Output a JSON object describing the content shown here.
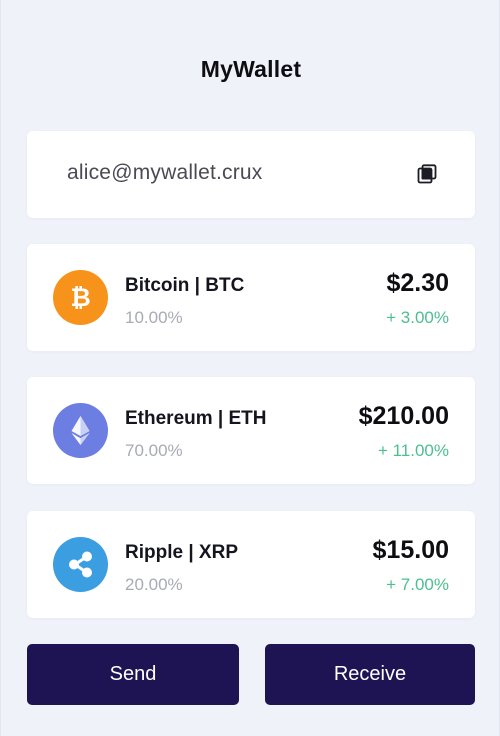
{
  "app": {
    "title": "MyWallet"
  },
  "address": {
    "value": "alice@mywallet.crux",
    "copy_icon": "copy-icon"
  },
  "assets": [
    {
      "name": "Bitcoin | BTC",
      "percent": "10.00%",
      "value": "$2.30",
      "change": "+ 3.00%",
      "icon": "bitcoin-icon",
      "color": "#f7931a"
    },
    {
      "name": "Ethereum | ETH",
      "percent": "70.00%",
      "value": "$210.00",
      "change": "+ 11.00%",
      "icon": "ethereum-icon",
      "color": "#6c7ee1"
    },
    {
      "name": "Ripple | XRP",
      "percent": "20.00%",
      "value": "$15.00",
      "change": "+ 7.00%",
      "icon": "ripple-icon",
      "color": "#3a9ee0"
    }
  ],
  "actions": {
    "send_label": "Send",
    "receive_label": "Receive"
  },
  "colors": {
    "background": "#f0f2f9",
    "button": "#1e1454",
    "positive_change": "#4cbf8f"
  }
}
